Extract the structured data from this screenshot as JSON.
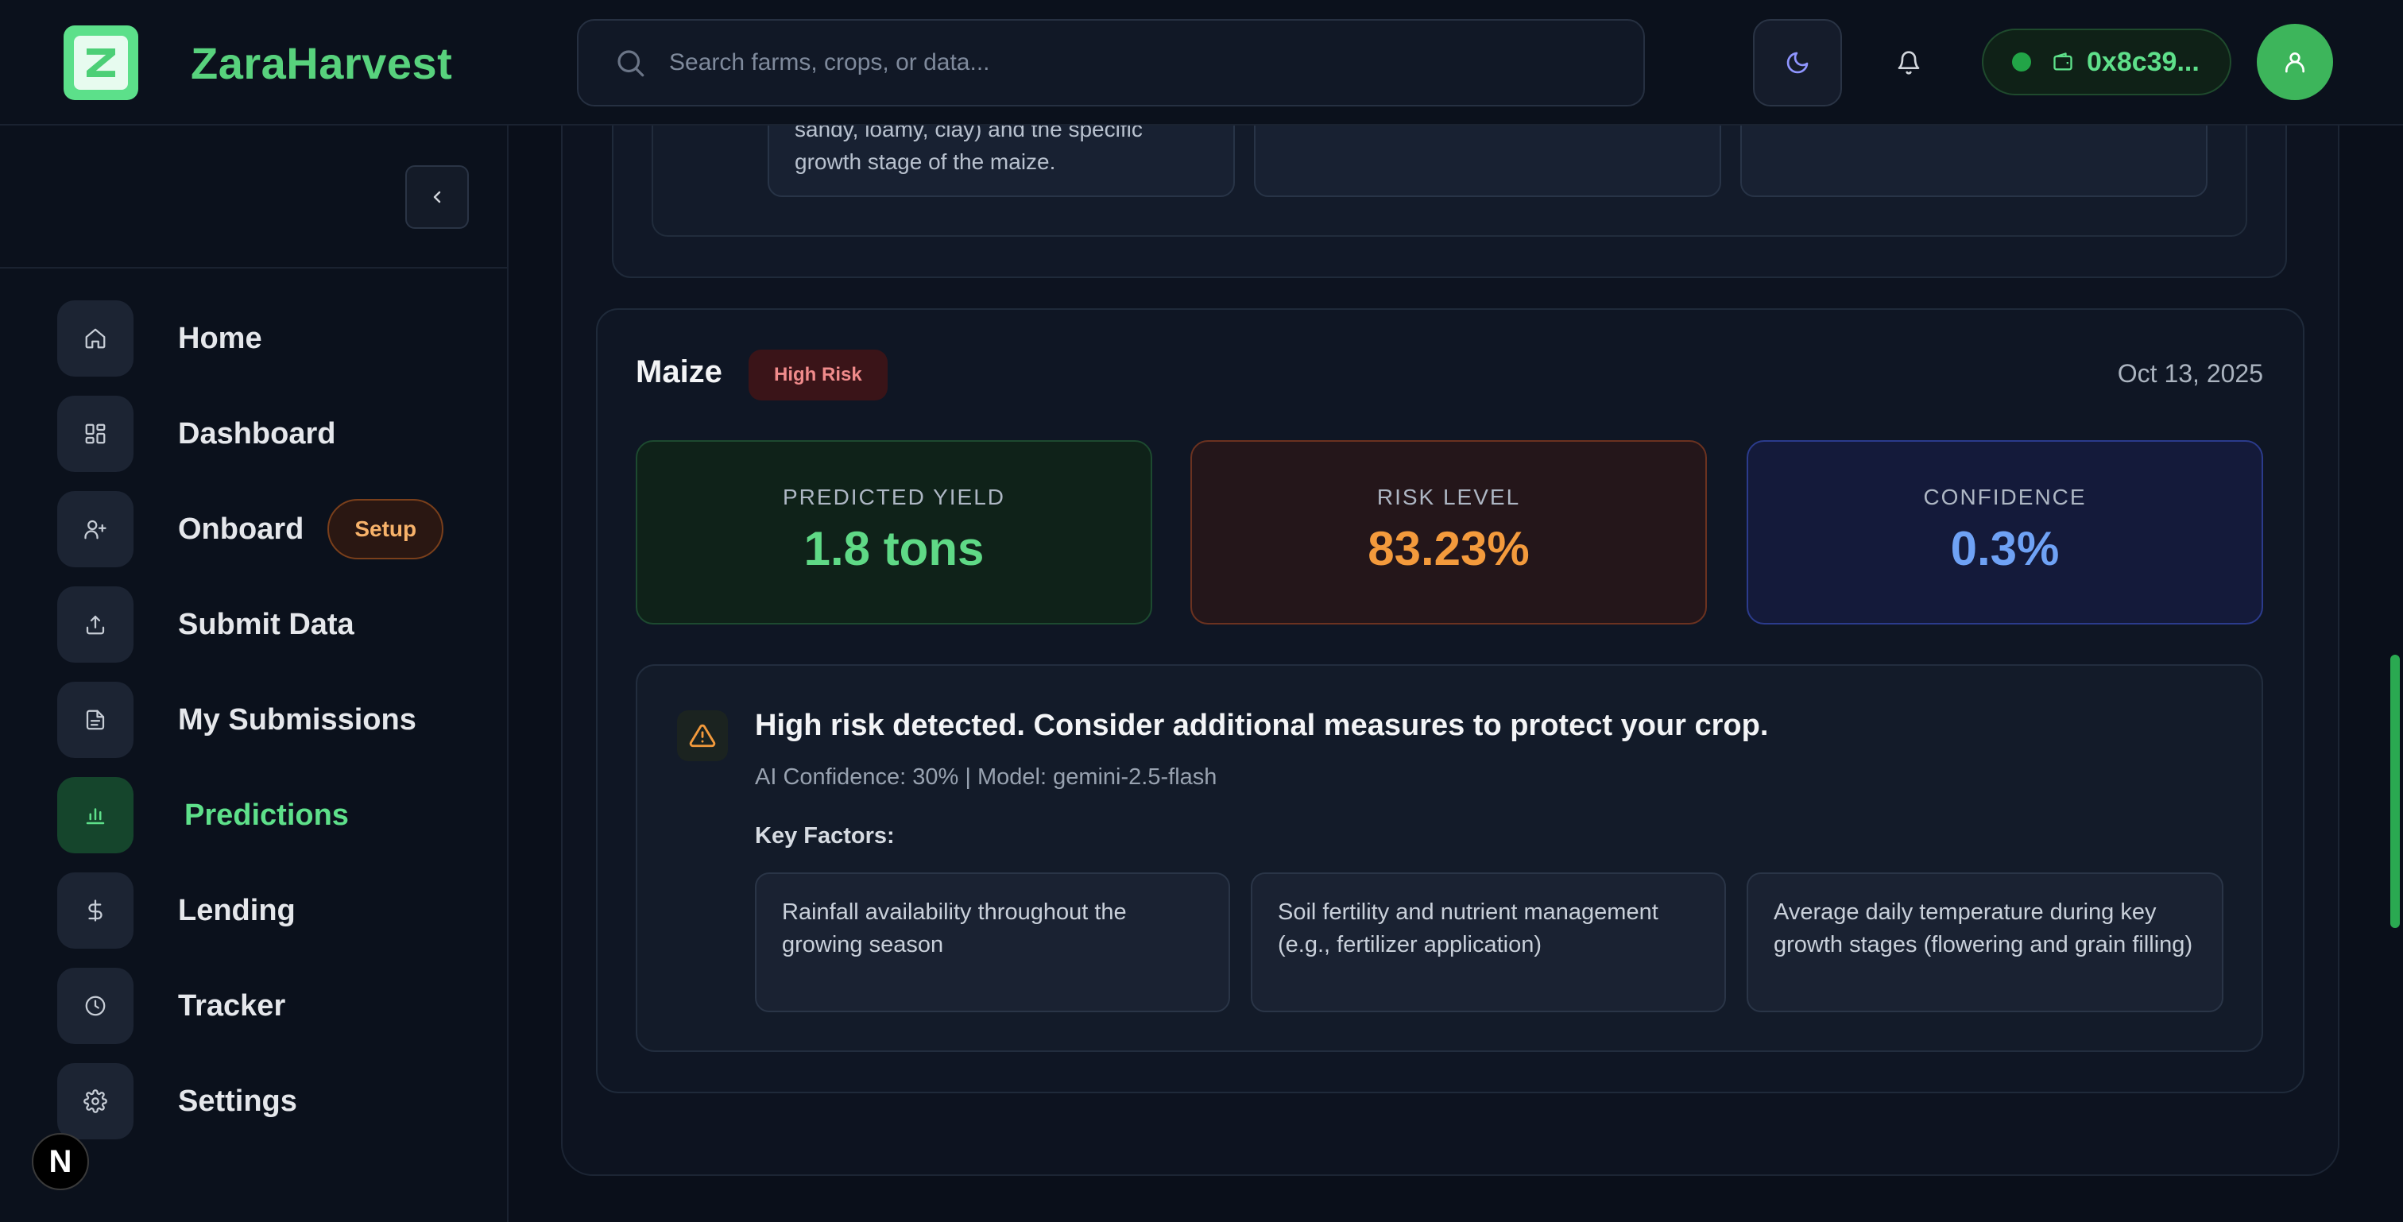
{
  "app": {
    "brand": "ZaraHarvest"
  },
  "header": {
    "search_placeholder": "Search farms, crops, or data...",
    "wallet_address": "0x8c39...",
    "icons": [
      "search-icon",
      "moon-icon",
      "bell-icon",
      "wallet-icon",
      "user-icon"
    ]
  },
  "sidebar": {
    "items": [
      {
        "label": "Home",
        "icon": "home-icon"
      },
      {
        "label": "Dashboard",
        "icon": "grid-icon"
      },
      {
        "label": "Onboard",
        "icon": "user-plus-icon",
        "badge": "Setup"
      },
      {
        "label": "Submit Data",
        "icon": "upload-icon"
      },
      {
        "label": "My Submissions",
        "icon": "document-icon"
      },
      {
        "label": "Predictions",
        "icon": "bar-chart-icon",
        "active": true
      },
      {
        "label": "Lending",
        "icon": "dollar-icon"
      },
      {
        "label": "Tracker",
        "icon": "clock-icon"
      },
      {
        "label": "Settings",
        "icon": "gear-icon"
      }
    ],
    "footer_logo": "N"
  },
  "previous_card": {
    "factor_text": "sandy, loamy, clay) and the specific growth stage of the maize."
  },
  "prediction": {
    "crop": "Maize",
    "risk_badge": "High Risk",
    "date": "Oct 13, 2025",
    "metrics": {
      "yield": {
        "label": "PREDICTED YIELD",
        "value": "1.8 tons"
      },
      "risk": {
        "label": "RISK LEVEL",
        "value": "83.23%"
      },
      "confidence": {
        "label": "CONFIDENCE",
        "value": "0.3%"
      }
    },
    "insight": {
      "title": "High risk detected. Consider additional measures to protect your crop.",
      "meta": "AI Confidence: 30% | Model: gemini-2.5-flash",
      "key_factors_heading": "Key Factors:",
      "factors": [
        "Rainfall availability throughout the growing season",
        "Soil fertility and nutrient management (e.g., fertilizer application)",
        "Average daily temperature during key growth stages (flowering and grain filling)"
      ]
    }
  },
  "colors": {
    "accent_green": "#5ee08a",
    "risk_orange": "#f39a3c",
    "confidence_blue": "#6fa2f5",
    "risk_badge_text": "#f08b8b"
  }
}
